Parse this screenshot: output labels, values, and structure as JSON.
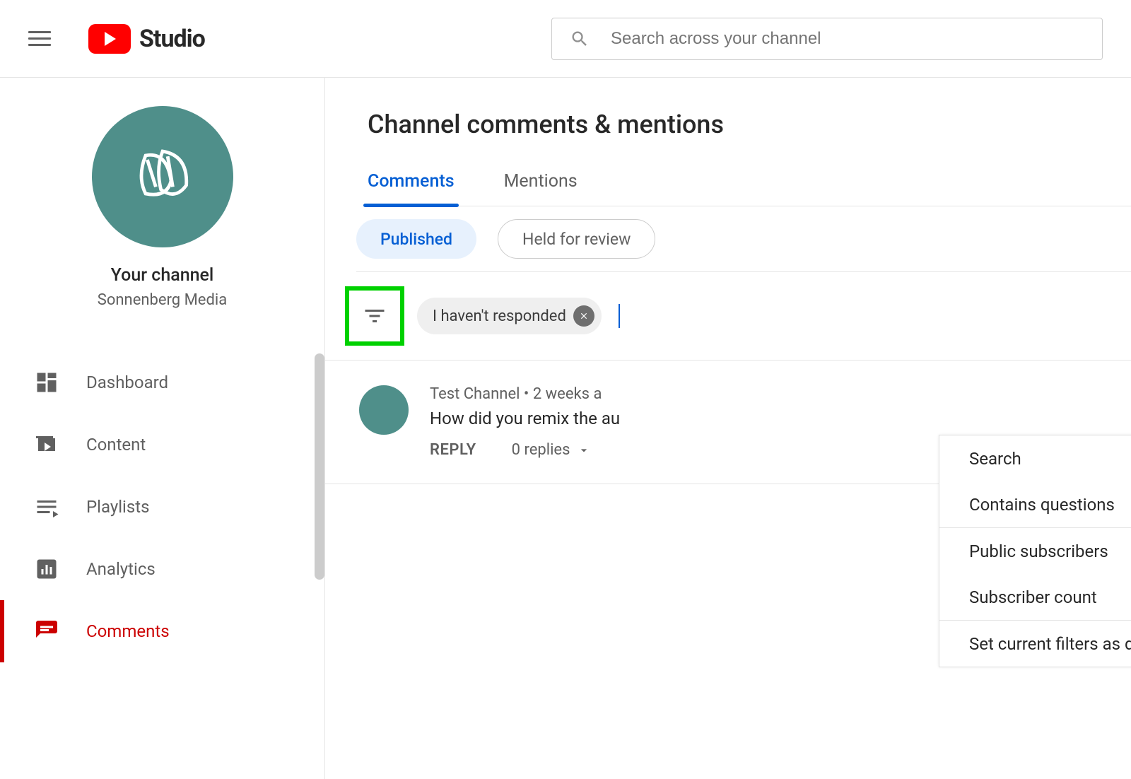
{
  "header": {
    "logo_text": "Studio",
    "search_placeholder": "Search across your channel"
  },
  "sidebar": {
    "channel_heading": "Your channel",
    "channel_name": "Sonnenberg Media",
    "items": [
      {
        "label": "Dashboard",
        "icon": "dashboard"
      },
      {
        "label": "Content",
        "icon": "content"
      },
      {
        "label": "Playlists",
        "icon": "playlists"
      },
      {
        "label": "Analytics",
        "icon": "analytics"
      },
      {
        "label": "Comments",
        "icon": "comments",
        "active": true
      }
    ]
  },
  "main": {
    "title": "Channel comments & mentions",
    "tabs": [
      "Comments",
      "Mentions"
    ],
    "active_tab": "Comments",
    "subtabs": [
      "Published",
      "Held for review"
    ],
    "active_subtab": "Published",
    "filter_chip": "I haven't responded",
    "comment": {
      "author": "Test Channel",
      "meta_sep": " • ",
      "time": "2 weeks a",
      "text": "How did you remix the au",
      "reply_label": "REPLY",
      "replies": "0 replies"
    },
    "filter_menu": [
      "Search",
      "Contains questions",
      "Public subscribers",
      "Subscriber count",
      "Set current filters as default"
    ]
  }
}
